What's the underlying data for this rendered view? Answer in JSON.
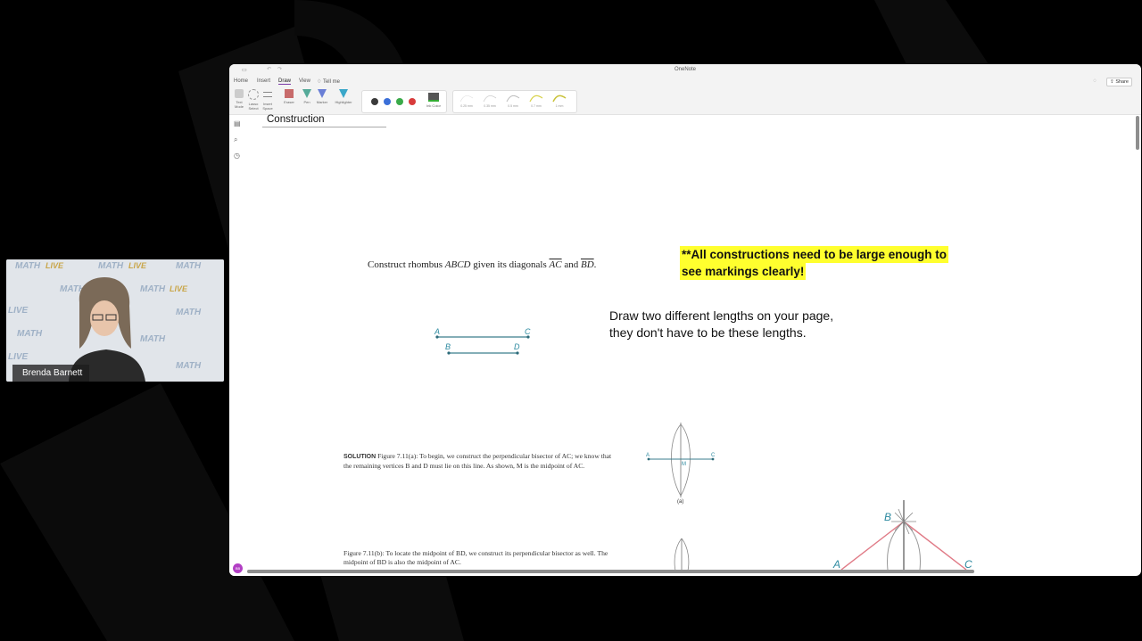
{
  "presenter": {
    "name": "Brenda Barnett",
    "backdrop_logo": "MATH LIVE"
  },
  "app": {
    "title": "OneNote",
    "tabs": [
      "Home",
      "Insert",
      "Draw",
      "View"
    ],
    "active_tab": "Draw",
    "tell_me": "Tell me",
    "share_label": "Share",
    "tools": [
      "Text Mode",
      "Lasso Select",
      "Insert Space",
      "Eraser",
      "Pen",
      "Marker",
      "Highlighter"
    ],
    "ink_color_label": "Ink Color",
    "pen_colors": [
      "#3a3a3a",
      "#3b6fd8",
      "#3aaa4a",
      "#d83b3b"
    ],
    "pen_sizes": [
      "0.25 mm",
      "0.35 mm",
      "0.5 mm",
      "0.7 mm",
      "1 mm"
    ],
    "avatar_initials": "BB"
  },
  "page": {
    "title": "Construction",
    "problem_pre": "Construct rhombus ",
    "problem_shape": "ABCD",
    "problem_mid": " given its diagonals ",
    "problem_d1": "AC",
    "problem_and": " and ",
    "problem_d2": "BD",
    "problem_end": ".",
    "note_line1": "**All constructions need to be large enough to",
    "note_line2": "see markings clearly!",
    "hint_line1": "Draw two different lengths on your page,",
    "hint_line2": "they don't have to be these lengths.",
    "solution_label": "SOLUTION",
    "solution_text": "Figure 7.11(a): To begin, we construct the perpendicular bisector of AC; we know that the remaining vertices B and D must lie on this line. As shown, M is the midpoint of AC.",
    "fig_b_text": "Figure 7.11(b): To locate the midpoint of BD, we construct its perpendicular bisector as well. The midpoint of BD is also the midpoint of AC.",
    "fig_a_caption": "(a)",
    "seg_labels": {
      "a": "A",
      "c": "C",
      "b": "B",
      "d": "D"
    },
    "fig_labels": {
      "a": "A",
      "c": "C",
      "m": "M"
    },
    "big_labels": {
      "a": "A",
      "b": "B",
      "c": "C"
    }
  }
}
